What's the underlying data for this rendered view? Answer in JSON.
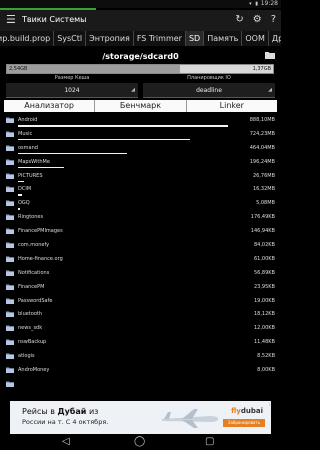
{
  "status_bar": {
    "time": "19:28",
    "icons": [
      "wifi-icon",
      "battery-icon"
    ]
  },
  "app_bar": {
    "title": "Твики Системы",
    "menu_icon": "hamburger-icon",
    "actions": [
      "refresh-icon",
      "settings-icon",
      "help-icon"
    ]
  },
  "tabs": [
    {
      "label": "ир.build.prop"
    },
    {
      "label": "SysCtl"
    },
    {
      "label": "Энтропия"
    },
    {
      "label": "FS Trimmer"
    },
    {
      "label": "SD",
      "active": true
    },
    {
      "label": "Память"
    },
    {
      "label": "OOM"
    },
    {
      "label": "Другие"
    }
  ],
  "storage": {
    "path": "/storage/sdcard0",
    "used_label": "2,54GB",
    "free_label": "1,37GB",
    "used_fraction": 0.65
  },
  "cache_size": {
    "label": "Размер Кеша",
    "value": "1024"
  },
  "scheduler": {
    "label": "Планировщик IO",
    "value": "deadline"
  },
  "subtabs": [
    {
      "label": "Анализатор"
    },
    {
      "label": "Бенчмарк"
    },
    {
      "label": "Linker"
    }
  ],
  "folders": [
    {
      "name": "Android",
      "size": "888,10MB",
      "fraction": 1.0
    },
    {
      "name": "Music",
      "size": "724,23MB",
      "fraction": 0.82
    },
    {
      "name": "osmand",
      "size": "464,04MB",
      "fraction": 0.52
    },
    {
      "name": "MapsWithMe",
      "size": "196,24MB",
      "fraction": 0.22
    },
    {
      "name": "PICTURES",
      "size": "26,76MB",
      "fraction": 0.03
    },
    {
      "name": "DCIM",
      "size": "16,32MB",
      "fraction": 0.02
    },
    {
      "name": "OGQ",
      "size": "5,08MB",
      "fraction": 0.01
    },
    {
      "name": "Ringtones",
      "size": "176,49KB",
      "fraction": 0
    },
    {
      "name": "FinancePMImages",
      "size": "146,94KB",
      "fraction": 0
    },
    {
      "name": "com.monefy",
      "size": "84,02KB",
      "fraction": 0
    },
    {
      "name": "Home-finance.org",
      "size": "61,00KB",
      "fraction": 0
    },
    {
      "name": "Notifications",
      "size": "56,89KB",
      "fraction": 0
    },
    {
      "name": "FinancePM",
      "size": "23,95KB",
      "fraction": 0
    },
    {
      "name": "PasswordSafe",
      "size": "19,00KB",
      "fraction": 0
    },
    {
      "name": "bluetooth",
      "size": "18,12KB",
      "fraction": 0
    },
    {
      "name": "news_sdk",
      "size": "12,00KB",
      "fraction": 0
    },
    {
      "name": "nswBackup",
      "size": "11,48KB",
      "fraction": 0
    },
    {
      "name": "atlogis",
      "size": "8,52KB",
      "fraction": 0
    },
    {
      "name": "AndroMoney",
      "size": "8,00KB",
      "fraction": 0
    },
    {
      "name": "",
      "size": "",
      "fraction": 0
    }
  ],
  "ad": {
    "line1_prefix": "Рейсы в ",
    "line1_bold": "Дубай",
    "line1_suffix": " из",
    "line2": "России на т. С 4 октября.",
    "brand_main": "fly",
    "brand_rest": "dubai",
    "cta": "Забронировать",
    "info": "i"
  },
  "nav_bar": {
    "buttons": [
      "back-icon",
      "home-icon",
      "recents-icon"
    ]
  },
  "colors": {
    "accent_green": "#3aa03a",
    "background": "#000000",
    "ad_orange": "#e67e22"
  }
}
